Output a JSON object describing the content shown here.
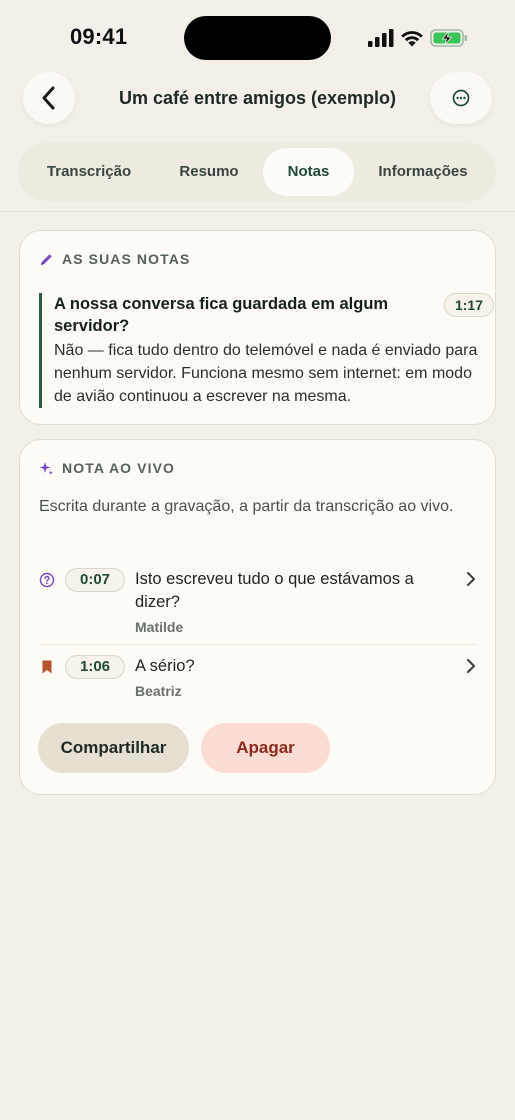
{
  "status": {
    "time": "09:41"
  },
  "header": {
    "title": "Um café entre amigos (exemplo)",
    "back_icon": "chevron-left-icon",
    "more_icon": "ellipsis-circle-icon"
  },
  "tabs": [
    {
      "label": "Transcrição",
      "active": false
    },
    {
      "label": "Resumo",
      "active": false
    },
    {
      "label": "Notas",
      "active": true
    },
    {
      "label": "Informações",
      "active": false
    }
  ],
  "your_notes": {
    "heading": "AS SUAS NOTAS",
    "icon": "pencil-icon",
    "note": {
      "question": "A nossa conversa fica guardada em algum servidor?",
      "answer": "Não — fica tudo dentro do telemóvel e nada é enviado para nenhum servidor. Funciona mesmo sem internet: em modo de avião continuou a escrever na mesma.",
      "time": "1:17"
    }
  },
  "live_note": {
    "heading": "NOTA AO VIVO",
    "icon": "sparkle-icon",
    "description": "Escrita durante a gravação, a partir da transcrição ao vivo.",
    "items": [
      {
        "icon": "question-circle-icon",
        "time": "0:07",
        "text": "Isto escreveu tudo o que estávamos a dizer?",
        "author": "Matilde"
      },
      {
        "icon": "bookmark-icon",
        "time": "1:06",
        "text": "A sério?",
        "author": "Beatriz"
      }
    ],
    "share_label": "Compartilhar",
    "delete_label": "Apagar"
  },
  "colors": {
    "accent": "#1d4b34",
    "background": "#f4f0e9",
    "danger": "#8b2a1c",
    "danger_bg": "#fbdcd5",
    "purple": "#7a4fc0"
  }
}
